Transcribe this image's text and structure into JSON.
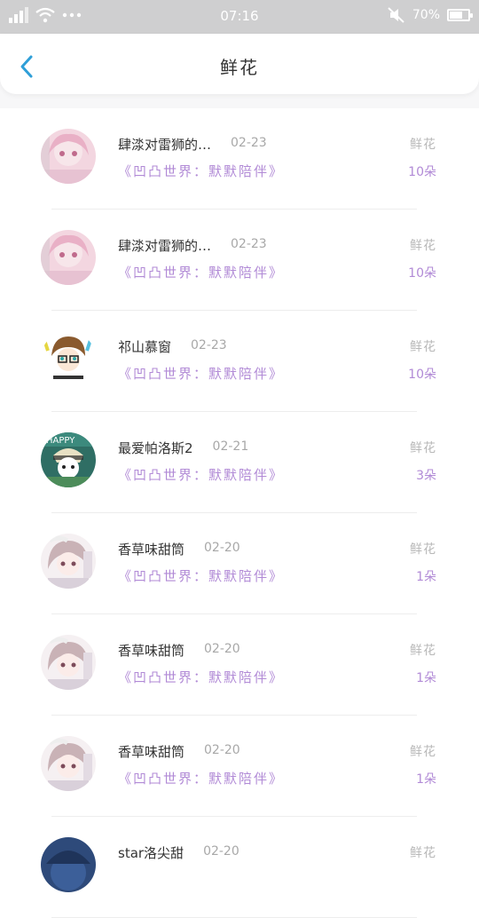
{
  "status_bar": {
    "time": "07:16",
    "battery_percent": "70%",
    "battery_level": 0.7,
    "icons": [
      "signal-icon",
      "wifi-icon",
      "more-dots-icon",
      "mute-icon",
      "battery-icon"
    ]
  },
  "header": {
    "title": "鲜花",
    "back_icon": "chevron-left-icon"
  },
  "colors": {
    "accent": "#2f9fd8",
    "purple": "#b18ad6",
    "muted": "#b8b8b8"
  },
  "items": [
    {
      "name": "肆渁对雷狮的…",
      "date": "02-23",
      "desc": "《凹凸世界：默默陪伴》",
      "type": "鲜花",
      "count": "10朵",
      "avatar": "pink-girl"
    },
    {
      "name": "肆渁对雷狮的…",
      "date": "02-23",
      "desc": "《凹凸世界：默默陪伴》",
      "type": "鲜花",
      "count": "10朵",
      "avatar": "pink-girl"
    },
    {
      "name": "祁山慕窗",
      "date": "02-23",
      "desc": "《凹凸世界：默默陪伴》",
      "type": "鲜花",
      "count": "10朵",
      "avatar": "brown-hair-boy"
    },
    {
      "name": "最爱帕洛斯2",
      "date": "02-21",
      "desc": "《凹凸世界：默默陪伴》",
      "type": "鲜花",
      "count": "3朵",
      "avatar": "teal-happy"
    },
    {
      "name": "香草味甜筒",
      "date": "02-20",
      "desc": "《凹凸世界：默默陪伴》",
      "type": "鲜花",
      "count": "1朵",
      "avatar": "anime-girl"
    },
    {
      "name": "香草味甜筒",
      "date": "02-20",
      "desc": "《凹凸世界：默默陪伴》",
      "type": "鲜花",
      "count": "1朵",
      "avatar": "anime-girl"
    },
    {
      "name": "香草味甜筒",
      "date": "02-20",
      "desc": "《凹凸世界：默默陪伴》",
      "type": "鲜花",
      "count": "1朵",
      "avatar": "anime-girl"
    },
    {
      "name": "star洛尖甜",
      "date": "02-20",
      "desc": "",
      "type": "鲜花",
      "count": "",
      "avatar": "dark-blue"
    }
  ]
}
